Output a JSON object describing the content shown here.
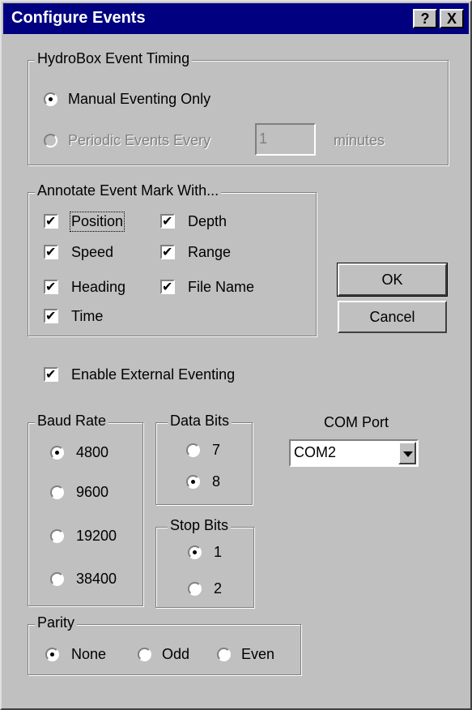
{
  "window": {
    "title": "Configure Events",
    "help_glyph": "?",
    "close_glyph": "X"
  },
  "timing": {
    "legend": "HydroBox Event Timing",
    "manual": {
      "label": "Manual Eventing Only",
      "selected": true
    },
    "periodic": {
      "label": "Periodic Events Every",
      "selected": false,
      "enabled": false,
      "value": "1",
      "unit": "minutes"
    }
  },
  "annotate": {
    "legend": "Annotate Event Mark With...",
    "items": [
      {
        "label": "Position",
        "checked": true
      },
      {
        "label": "Depth",
        "checked": true
      },
      {
        "label": "Speed",
        "checked": true
      },
      {
        "label": "Range",
        "checked": true
      },
      {
        "label": "Heading",
        "checked": true
      },
      {
        "label": "File Name",
        "checked": true
      },
      {
        "label": "Time",
        "checked": true
      }
    ]
  },
  "buttons": {
    "ok": "OK",
    "cancel": "Cancel"
  },
  "external": {
    "label": "Enable External Eventing",
    "checked": true
  },
  "baud": {
    "legend": "Baud Rate",
    "options": [
      "4800",
      "9600",
      "19200",
      "38400"
    ],
    "selected": "4800"
  },
  "data_bits": {
    "legend": "Data Bits",
    "options": [
      "7",
      "8"
    ],
    "selected": "8"
  },
  "stop_bits": {
    "legend": "Stop Bits",
    "options": [
      "1",
      "2"
    ],
    "selected": "1"
  },
  "com_port": {
    "label": "COM Port",
    "value": "COM2"
  },
  "parity": {
    "legend": "Parity",
    "options": [
      "None",
      "Odd",
      "Even"
    ],
    "selected": "None"
  }
}
